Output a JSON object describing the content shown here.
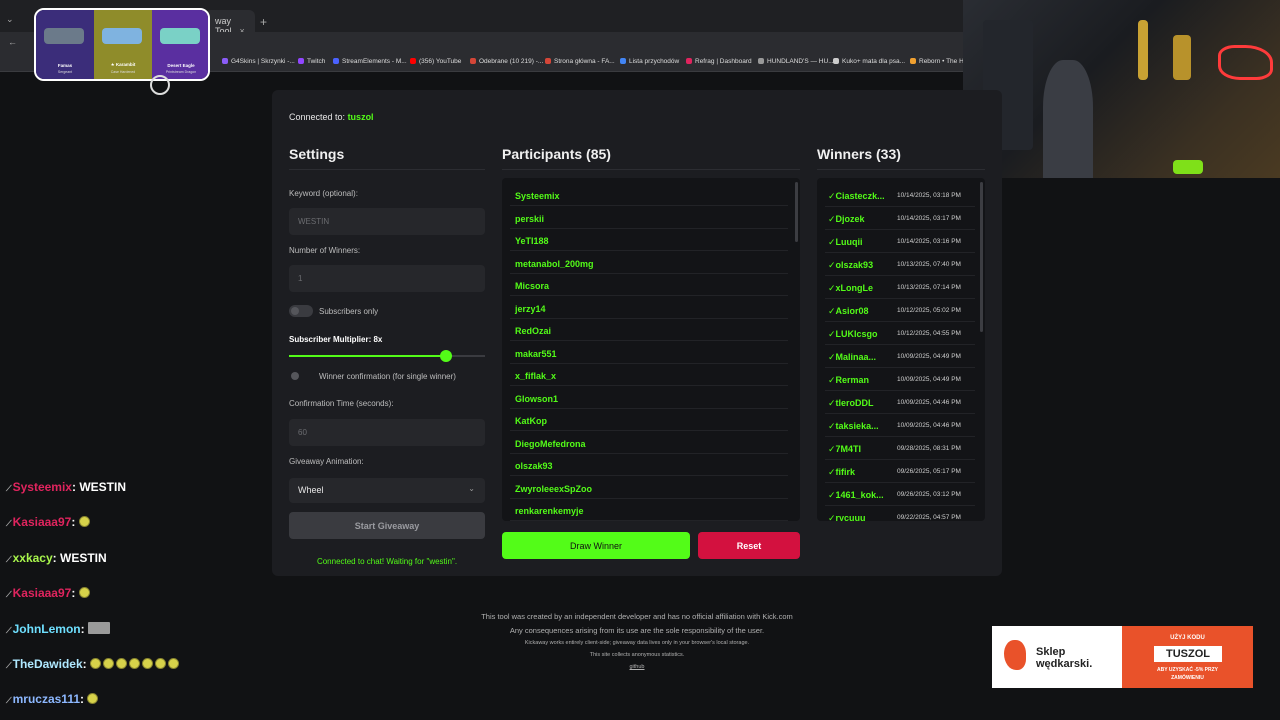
{
  "browser": {
    "tab_title": "way Tool",
    "new_tab": "+",
    "tab_close": "×",
    "bookmarks": [
      {
        "label": "G4Skins | Skrzynki -...",
        "color": "#8a5cf6"
      },
      {
        "label": "Twitch",
        "color": "#9146ff"
      },
      {
        "label": "StreamElements - M...",
        "color": "#4b62ff"
      },
      {
        "label": "(356) YouTube",
        "color": "#ff0000"
      },
      {
        "label": "Odebrane (10 219) -...",
        "color": "#d44638"
      },
      {
        "label": "Strona główna - FA...",
        "color": "#d44638"
      },
      {
        "label": "Lista przychodów",
        "color": "#4285f4"
      },
      {
        "label": "Refrag | Dashboard",
        "color": "#e0245e"
      },
      {
        "label": "HUNDLAND'S — HU...",
        "color": "#999999"
      },
      {
        "label": "Kuko+ mata dla psa...",
        "color": "#cccccc"
      },
      {
        "label": "Reborn • The Ha",
        "color": "#f0a030"
      }
    ]
  },
  "skin_popup": {
    "skins": [
      {
        "name": "Famas",
        "sub": "Sergeant"
      },
      {
        "name": "★ Karambit",
        "sub": "Case Hardened"
      },
      {
        "name": "Desert Eagle",
        "sub": "Printstream Dragon"
      }
    ]
  },
  "app": {
    "connected_label": "Connected to:",
    "channel": "tuszol",
    "settings": {
      "title": "Settings",
      "keyword_label": "Keyword (optional):",
      "keyword_placeholder": "WESTIN",
      "winners_label": "Number of Winners:",
      "winners_value": "1",
      "subs_only_label": "Subscribers only",
      "multiplier_label": "Subscriber Multiplier: 8x",
      "multiplier_value": 8,
      "multiplier_max": 10,
      "confirm_label": "Winner confirmation (for single winner)",
      "confirm_time_label": "Confirmation Time (seconds):",
      "confirm_time_value": "60",
      "animation_label": "Giveaway Animation:",
      "animation_value": "Wheel",
      "start_button": "Start Giveaway",
      "status": "Connected to chat! Waiting for \"westin\"."
    },
    "participants": {
      "title": "Participants (85)",
      "names": [
        "Systeemix",
        "perskii",
        "YeTI188",
        "metanabol_200mg",
        "Micsora",
        "jerzy14",
        "RedOzai",
        "makar551",
        "x_fiflak_x",
        "Glowson1",
        "KatKop",
        "DiegoMefedrona",
        "olszak93",
        "ZwyroleeexSpZoo",
        "renkarenkemyje"
      ],
      "draw_button": "Draw Winner",
      "reset_button": "Reset"
    },
    "winners": {
      "title": "Winners (33)",
      "check": "✓",
      "rows": [
        {
          "name": "Ciasteczk...",
          "date": "10/14/2025, 03:18 PM"
        },
        {
          "name": "Djozek",
          "date": "10/14/2025, 03:17 PM"
        },
        {
          "name": "Luuqii",
          "date": "10/14/2025, 03:16 PM"
        },
        {
          "name": "olszak93",
          "date": "10/13/2025, 07:40 PM"
        },
        {
          "name": "xLongLe",
          "date": "10/13/2025, 07:14 PM"
        },
        {
          "name": "Asior08",
          "date": "10/12/2025, 05:02 PM"
        },
        {
          "name": "LUKIcsgo",
          "date": "10/12/2025, 04:55 PM"
        },
        {
          "name": "Malinaa...",
          "date": "10/09/2025, 04:49 PM"
        },
        {
          "name": "Rerman",
          "date": "10/09/2025, 04:49 PM"
        },
        {
          "name": "tleroDDL",
          "date": "10/09/2025, 04:46 PM"
        },
        {
          "name": "taksieka...",
          "date": "10/09/2025, 04:46 PM"
        },
        {
          "name": "7M4TI",
          "date": "09/28/2025, 08:31 PM"
        },
        {
          "name": "fifirk",
          "date": "09/26/2025, 05:17 PM"
        },
        {
          "name": "1461_kok...",
          "date": "09/26/2025, 03:12 PM"
        },
        {
          "name": "rycuuu",
          "date": "09/22/2025, 04:57 PM"
        }
      ]
    },
    "footer": {
      "line1": "This tool was created by an independent developer and has no official affiliation with Kick.com",
      "line2": "Any consequences arising from its use are the sole responsibility of the user.",
      "line3": "Kickaway works entirely client-side; giveaway data lives only in your browser's local storage.",
      "line4": "This site collects anonymous statistics.",
      "link": "github"
    }
  },
  "chat": [
    {
      "user": "Systeemix",
      "color": "#e0245e",
      "message": ": WESTIN",
      "emotes": 0
    },
    {
      "user": "Kasiaaa97",
      "color": "#e0245e",
      "message": ": ",
      "emotes": 1
    },
    {
      "user": "xxkacy",
      "color": "#a8f54c",
      "message": ": WESTIN",
      "emotes": 0
    },
    {
      "user": "Kasiaaa97",
      "color": "#e0245e",
      "message": ": ",
      "emotes": 1
    },
    {
      "user": "JohnLemon",
      "color": "#6fe0ff",
      "message": ": ",
      "emotes": 0,
      "square": true
    },
    {
      "user": "TheDawidek",
      "color": "#b0e8ff",
      "message": ": ",
      "emotes": 7
    },
    {
      "user": "mruczas111",
      "color": "#8db8ff",
      "message": ": ",
      "emotes": 1
    }
  ],
  "ad": {
    "brand_line1": "Sklep",
    "brand_line2": "wędkarski.",
    "use_code": "UŻYJ KODU",
    "code": "TUSZOL",
    "promo1": "ABY UZYSKAĆ -5% PRZY",
    "promo2": "ZAMÓWIENIU"
  }
}
